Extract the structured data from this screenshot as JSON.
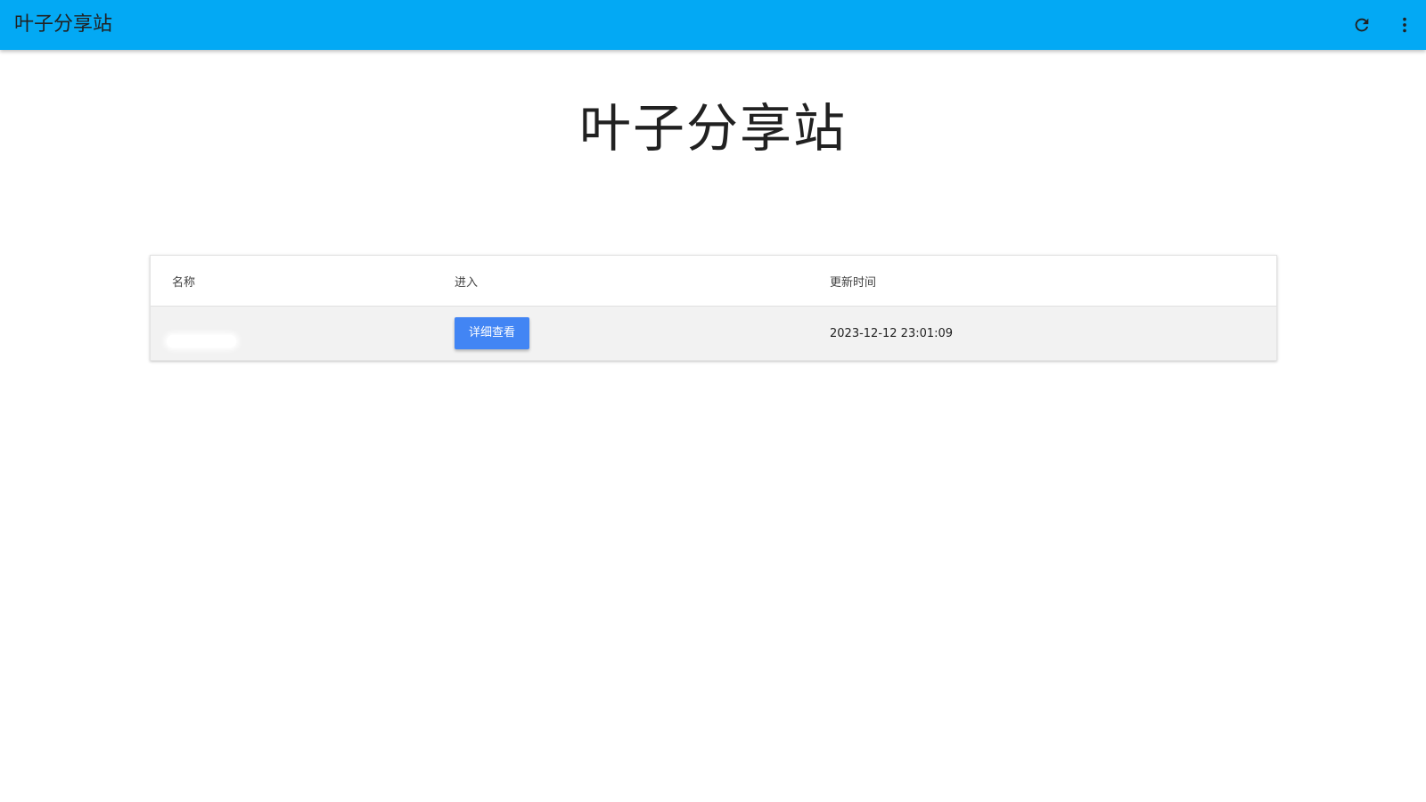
{
  "appbar": {
    "title": "叶子分享站",
    "actions": [
      {
        "name": "refresh-icon"
      },
      {
        "name": "more-vert-icon"
      }
    ]
  },
  "hero": {
    "title": "叶子分享站"
  },
  "table": {
    "columns": [
      "名称",
      "进入",
      "更新时间"
    ],
    "rows": [
      {
        "name": "",
        "action_label": "详细查看",
        "updated": "2023-12-12 23:01:09"
      }
    ]
  },
  "colors": {
    "appbar": "#03a9f4",
    "button": "#4285f4",
    "row_bg": "#f2f2f2"
  }
}
